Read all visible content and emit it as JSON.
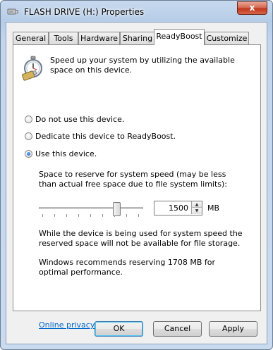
{
  "window": {
    "title": "FLASH DRIVE (H:) Properties",
    "close_glyph": "x"
  },
  "tabs": [
    {
      "label": "General"
    },
    {
      "label": "Tools"
    },
    {
      "label": "Hardware"
    },
    {
      "label": "Sharing"
    },
    {
      "label": "ReadyBoost",
      "active": true
    },
    {
      "label": "Customize"
    }
  ],
  "readyboost": {
    "intro": "Speed up your system by utilizing the available space on this device.",
    "options": [
      {
        "label": "Do not use this device.",
        "checked": false
      },
      {
        "label": "Dedicate this device to ReadyBoost.",
        "checked": false
      },
      {
        "label": "Use this device.",
        "checked": true
      }
    ],
    "reserve_label": "Space to reserve for system speed (may be less than actual free space due to file system limits):",
    "reserve_value": "1500",
    "reserve_unit": "MB",
    "slider_level": 0.77,
    "note_unavailable": "While the device is being used for system speed the reserved space will not be available for file storage.",
    "recommendation": "Windows recommends reserving 1708 MB for optimal performance.",
    "privacy_link": "Online privacy statement"
  },
  "buttons": {
    "ok": "OK",
    "cancel": "Cancel",
    "apply": "Apply"
  },
  "colors": {
    "link": "#0066cc",
    "close_button": "#c2371c",
    "window_frame": "#b6cce7"
  },
  "icons": {
    "title": "usb-drive-icon",
    "panel": "readyboost-stopwatch-icon"
  }
}
